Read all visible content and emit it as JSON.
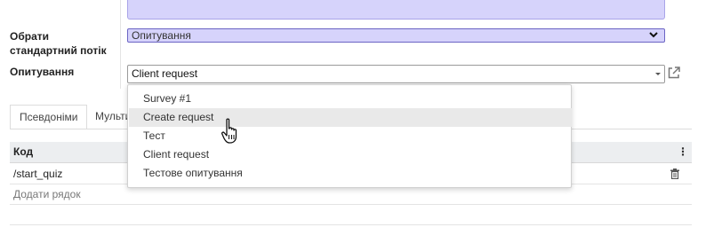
{
  "form": {
    "flow_label_line1": "Обрати",
    "flow_label_line2": "стандартний потік",
    "flow_value": "Опитування",
    "survey_label": "Опитування",
    "survey_value": "Client request"
  },
  "dropdown": {
    "options": [
      "Survey #1",
      "Create request",
      "Тест",
      "Client request",
      "Тестове опитування"
    ],
    "hovered_index": 1
  },
  "tabs": [
    {
      "label": "Псевдоніми",
      "active": true
    },
    {
      "label": "Мульти",
      "active": false
    }
  ],
  "table": {
    "column_header": "Код",
    "rows": [
      "/start_quiz"
    ],
    "add_row_label": "Додати рядок"
  },
  "colors": {
    "accent_fill": "#d6d3fb",
    "accent_border": "#6b64c4"
  },
  "icons": {
    "external_link": "external-link-icon",
    "trash": "trash-icon",
    "chevron": "chevron-down-icon",
    "caret": "caret-down-icon",
    "menu": "vertical-dots-icon",
    "cursor": "hand-pointer-icon"
  }
}
